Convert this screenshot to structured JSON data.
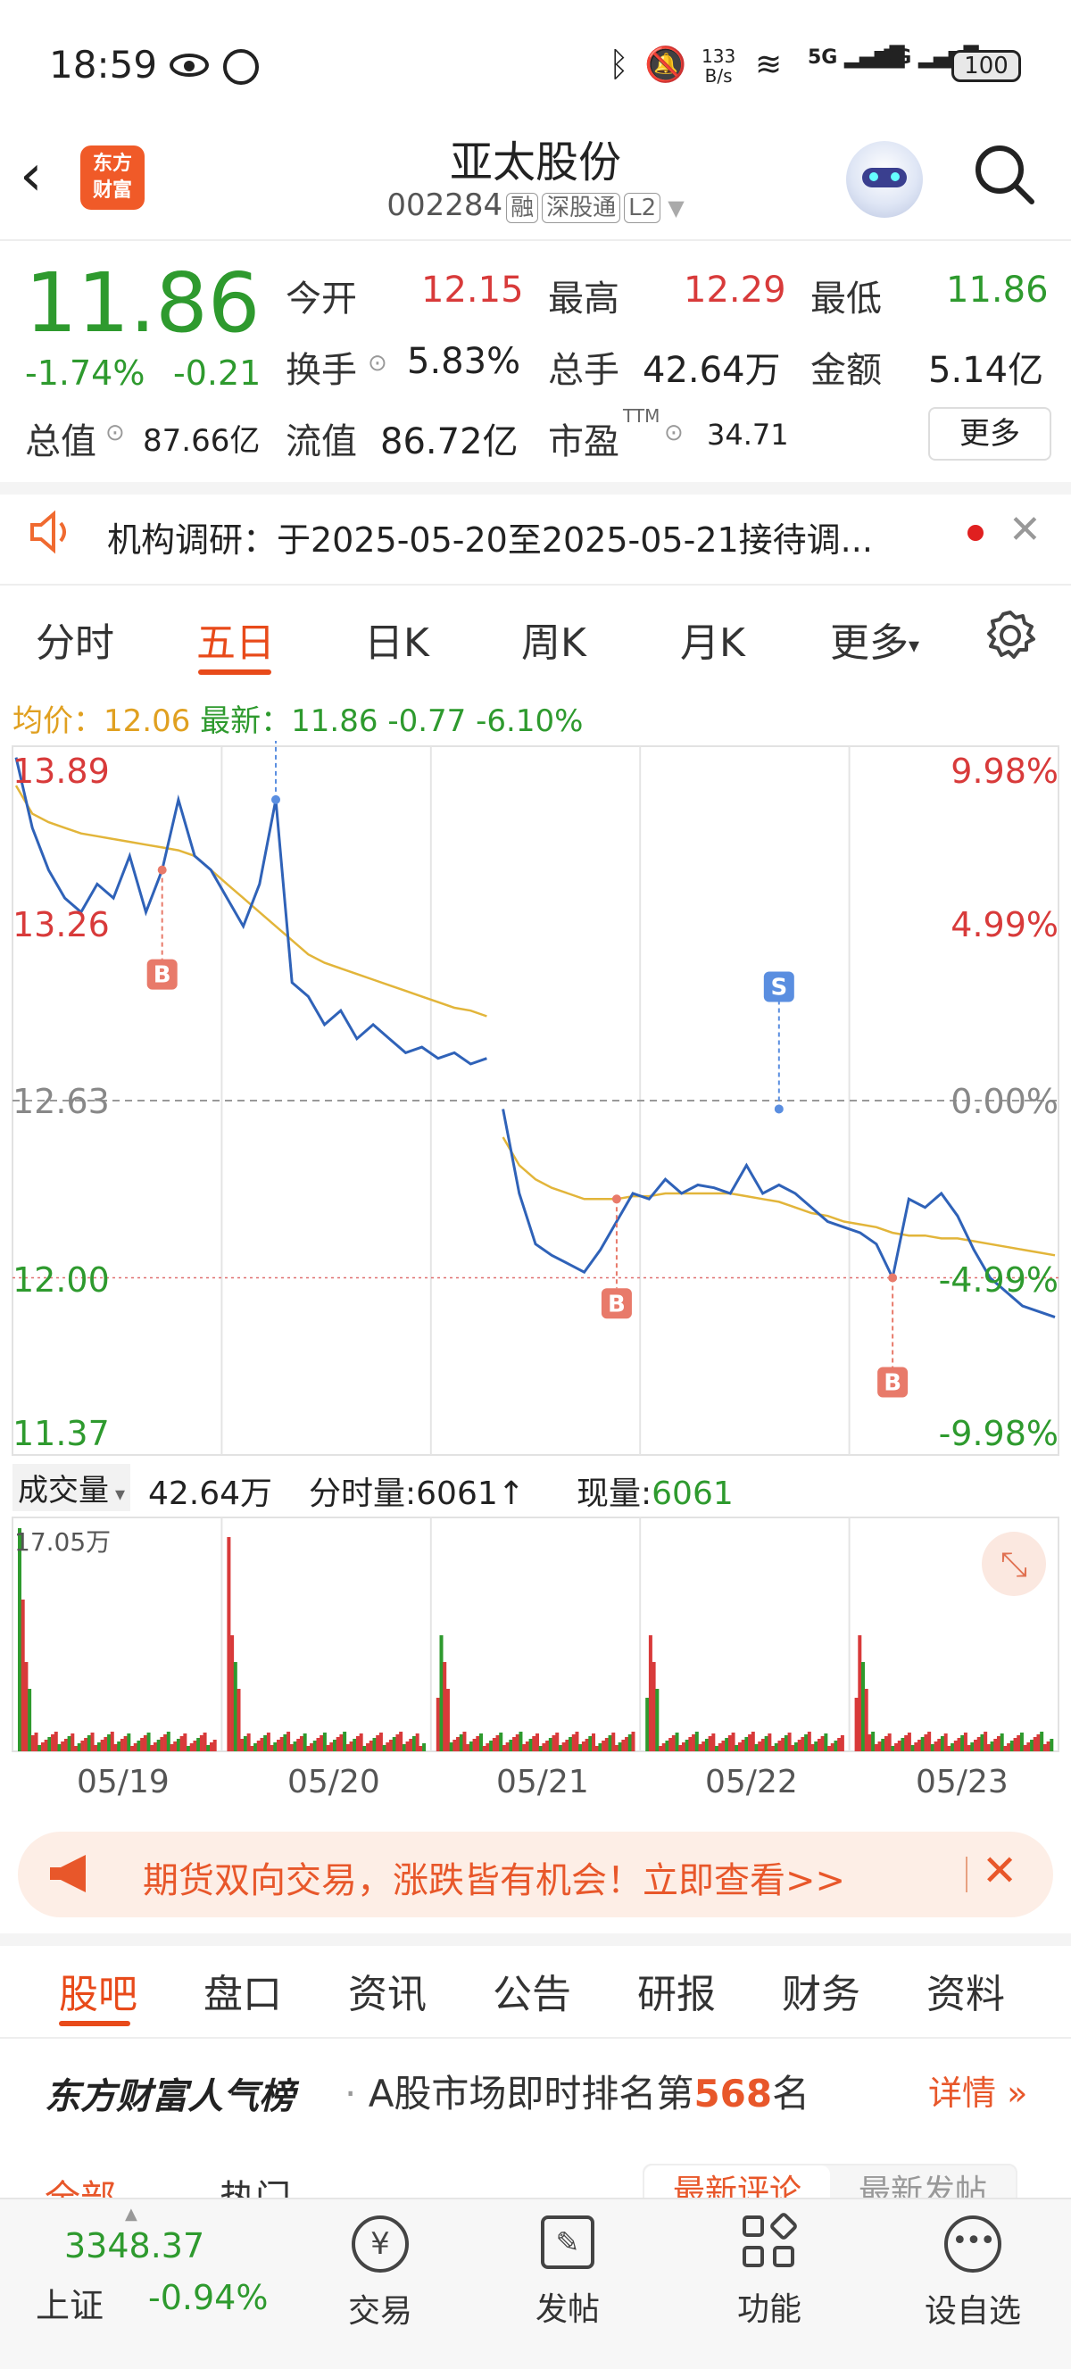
{
  "status_bar": {
    "time": "18:59",
    "net_speed_top": "133",
    "net_speed_bottom": "B/s",
    "net1": "5G",
    "net2": "5G",
    "battery": "100"
  },
  "header": {
    "logo_text_1": "东方",
    "logo_text_2": "财富",
    "title": "亚太股份",
    "code": "002284",
    "badges": [
      "融",
      "深股通",
      "L2"
    ]
  },
  "quote": {
    "price": "11.86",
    "change_pct": "-1.74%",
    "change_amt": "-0.21",
    "open_label": "今开",
    "open": "12.15",
    "high_label": "最高",
    "high": "12.29",
    "low_label": "最低",
    "low": "11.86",
    "turnover_label": "换手",
    "turnover": "5.83%",
    "volume_label": "总手",
    "volume": "42.64万",
    "amount_label": "金额",
    "amount": "5.14亿",
    "mktcap_label": "总值",
    "mktcap": "87.66亿",
    "float_label": "流值",
    "float": "86.72亿",
    "pe_label": "市盈",
    "pe_sup": "TTM",
    "pe": "34.71",
    "more_button": "更多"
  },
  "notice": {
    "text": "机构调研：于2025-05-20至2025-05-21接待调..."
  },
  "chart_tabs": [
    "分时",
    "五日",
    "日K",
    "周K",
    "月K",
    "更多"
  ],
  "active_tab": "五日",
  "chart_info": {
    "avg_label": "均价：",
    "avg": "12.06",
    "latest_label": "最新：",
    "latest": "11.86",
    "latest_chg": "-0.77",
    "latest_pct": "-6.10%"
  },
  "volume_info": {
    "label": "成交量",
    "total": "42.64万",
    "tick_label": "分时量:6061",
    "now_label": "现量:",
    "now": "6061",
    "vol_max": "17.05万"
  },
  "chart_data": {
    "type": "line",
    "y_labels_left": [
      "13.89",
      "13.26",
      "12.63",
      "12.00",
      "11.37"
    ],
    "y_labels_right": [
      "9.98%",
      "4.99%",
      "0.00%",
      "-4.99%",
      "-9.98%"
    ],
    "x_labels": [
      "05/19",
      "05/20",
      "05/21",
      "05/22",
      "05/23"
    ],
    "ylim": [
      11.37,
      13.89
    ],
    "prev_close": 12.63,
    "series": [
      {
        "name": "price",
        "values": [
          13.85,
          13.6,
          13.45,
          13.35,
          13.3,
          13.4,
          13.35,
          13.5,
          13.3,
          13.45,
          13.7,
          13.5,
          13.45,
          13.35,
          13.25,
          13.4,
          13.7,
          13.05,
          13.0,
          12.9,
          12.95,
          12.85,
          12.9,
          12.85,
          12.8,
          12.82,
          12.78,
          12.8,
          12.76,
          12.78,
          12.6,
          12.3,
          12.12,
          12.08,
          12.05,
          12.02,
          12.1,
          12.2,
          12.3,
          12.28,
          12.35,
          12.3,
          12.33,
          12.32,
          12.3,
          12.4,
          12.3,
          12.33,
          12.3,
          12.25,
          12.2,
          12.18,
          12.16,
          12.12,
          12.0,
          12.28,
          12.25,
          12.3,
          12.22,
          12.1,
          12.0,
          11.95,
          11.9,
          11.88,
          11.86
        ]
      },
      {
        "name": "avg",
        "values": [
          13.75,
          13.65,
          13.62,
          13.6,
          13.58,
          13.57,
          13.56,
          13.55,
          13.54,
          13.53,
          13.52,
          13.5,
          13.45,
          13.4,
          13.35,
          13.3,
          13.25,
          13.2,
          13.15,
          13.12,
          13.1,
          13.08,
          13.06,
          13.04,
          13.02,
          13.0,
          12.98,
          12.96,
          12.95,
          12.93,
          12.5,
          12.4,
          12.35,
          12.32,
          12.3,
          12.28,
          12.28,
          12.28,
          12.29,
          12.29,
          12.3,
          12.3,
          12.3,
          12.3,
          12.3,
          12.29,
          12.28,
          12.27,
          12.25,
          12.23,
          12.22,
          12.2,
          12.19,
          12.18,
          12.16,
          12.15,
          12.15,
          12.14,
          12.14,
          12.13,
          12.12,
          12.11,
          12.1,
          12.09,
          12.08
        ]
      }
    ],
    "trade_marks": [
      "B",
      "S",
      "S",
      "B",
      "B"
    ]
  },
  "banner": {
    "text": "期货双向交易，涨跌皆有机会！立即查看>>"
  },
  "bottom_tabs": [
    "股吧",
    "盘口",
    "资讯",
    "公告",
    "研报",
    "财务",
    "资料"
  ],
  "active_bottom_tab": "股吧",
  "popularity": {
    "brand": "东方财富人气榜",
    "prefix": "A股市场即时排名第",
    "rank": "568",
    "suffix": "名",
    "detail": "详情"
  },
  "filters": {
    "left": [
      "全部",
      "热门"
    ],
    "right": [
      "最新评论",
      "最新发帖"
    ]
  },
  "footer": {
    "index_value": "3348.37",
    "index_name": "上证",
    "index_change": "-0.94%",
    "items": [
      "交易",
      "发帖",
      "功能",
      "设自选"
    ]
  }
}
